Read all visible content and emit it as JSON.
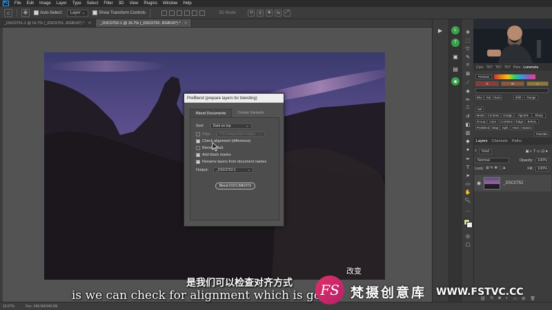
{
  "menubar": {
    "logo": "Ps",
    "items": [
      "File",
      "Edit",
      "Image",
      "Layer",
      "Type",
      "Select",
      "Filter",
      "3D",
      "View",
      "Plugins",
      "Window",
      "Help"
    ]
  },
  "options": {
    "auto_select_label": "Auto-Select:",
    "auto_select_value": "Layer",
    "transform_label": "Show Transform Controls",
    "mode_label": "3D Mode:"
  },
  "tabs": [
    {
      "label": "_DSC0751-1 @ 16.7% (_DSC0751, RGB/16*) *"
    },
    {
      "label": "_DSC0752-1 @ 16.7% (_DSC0752, RGB/16*) *"
    }
  ],
  "dialog": {
    "title": "PreBlend (prepare layers for blending)",
    "tab_active": "Blend Documents",
    "tab_other": "Create Variants",
    "sort_label": "Sort:",
    "sort_value": "Dark on top",
    "align_label": "Align",
    "align_value": "TIS independent edges",
    "check_alignment": "Check alignment (difference)",
    "blend_if": "BlendIf (Sat)",
    "add_masks": "Add black masks",
    "rename_layers": "Rename layers from document names",
    "output_label": "Output:",
    "output_value": "_DSC0752-1",
    "button": "Blend DOCUMENTS"
  },
  "lumenzia": {
    "tabs": [
      "Curs",
      "TK7",
      "TK7",
      "TK7",
      "Pers",
      "Lumenzia"
    ],
    "preview": "Preview",
    "zone_d": "D",
    "zone_m": "M",
    "zone_l": "L",
    "buttons": [
      "Blur",
      "Sat",
      "Sam",
      "Shift",
      "Range",
      "Sel",
      "Mask",
      "Contrast",
      "Dodge",
      "Vignette",
      "Sharp",
      "Group",
      "Color",
      "Combine",
      "Edge",
      "Before",
      "PreBlend",
      "Map",
      "Split",
      "Heal",
      "Basics",
      "Tutorials"
    ]
  },
  "layers": {
    "tabs": [
      "Layers",
      "Channels",
      "Paths"
    ],
    "kind": "Kind",
    "blend_mode": "Normal",
    "opacity_label": "Opacity:",
    "opacity_value": "100%",
    "lock_label": "Lock:",
    "fill_label": "Fill:",
    "fill_value": "100%",
    "layer_name": "_DSC0752"
  },
  "status": {
    "zoom": "16.67%",
    "doc": "Doc: 348.6M/348.6M"
  },
  "subtitle_cn": "是我们可以检查对齐方式",
  "subtitle_en": "is we can check for alignment which is goir",
  "subtitle_cn_right": "改变",
  "watermark": {
    "logo": "FS",
    "cn": "梵摄创意库",
    "en": "WWW.FSTVC.CC"
  },
  "colors": {
    "accent": "#31a8ff",
    "panel": "#3c3c3c",
    "workspace": "#535353",
    "watermark_pink": "#e0306a"
  }
}
